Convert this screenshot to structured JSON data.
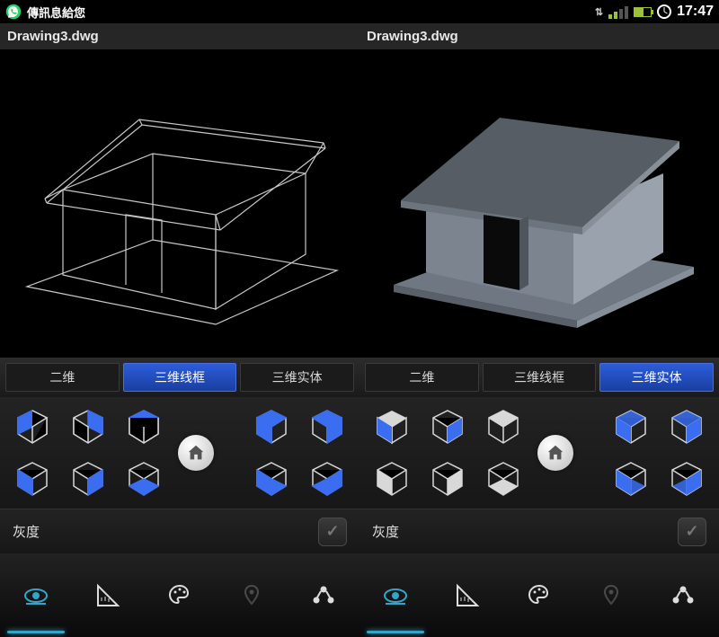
{
  "status": {
    "notification_text": "傳訊息給您",
    "time": "17:47"
  },
  "left": {
    "filename": "Drawing3.dwg",
    "tabs": {
      "t2d": "二维",
      "wire": "三维线框",
      "solid": "三维实体"
    },
    "active_tab": "wire",
    "grayscale_label": "灰度"
  },
  "right": {
    "filename": "Drawing3.dwg",
    "tabs": {
      "t2d": "二维",
      "wire": "三维线框",
      "solid": "三维实体"
    },
    "active_tab": "solid",
    "grayscale_label": "灰度"
  },
  "colors": {
    "accent_blue": "#3b6df0",
    "accent_cyan": "#31a6c9",
    "solid_house": "#8e97a1"
  }
}
